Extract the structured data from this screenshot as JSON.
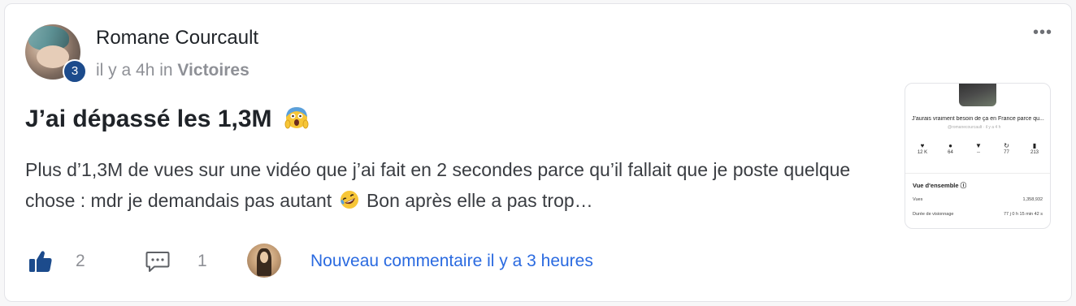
{
  "post": {
    "author": "Romane Courcault",
    "level": "3",
    "time_prefix": "il y a 4h",
    "in_word": "in",
    "space": "Victoires",
    "title": "J’ai dépassé les 1,3M",
    "body_part1": "Plus d’1,3M de vues sur une vidéo que j’ai fait en 2 secondes parce qu’il fallait que je poste quelque chose : mdr je demandais pas autant",
    "body_part2": " Bon après elle a pas trop…",
    "more_label": "•••"
  },
  "thumbnail": {
    "title": "J'aurais vraiment besoin de ça en France parce qu...",
    "subtitle": "@romanecourcault · il y a 4 h",
    "stats": [
      {
        "icon": "♥",
        "value": "12 K",
        "name": "likes"
      },
      {
        "icon": "●",
        "value": "64",
        "name": "comments"
      },
      {
        "icon": "▼",
        "value": "--",
        "name": "saves"
      },
      {
        "icon": "↻",
        "value": "77",
        "name": "shares"
      },
      {
        "icon": "▮",
        "value": "213",
        "name": "bookmarks"
      }
    ],
    "overview_label": "Vue d'ensemble ⓘ",
    "rows": [
      {
        "label": "Vues",
        "value": "1,358,932"
      },
      {
        "label": "Durée de visionnage",
        "value": "77 j 0 h 15 min 42 s"
      }
    ]
  },
  "footer": {
    "like_count": "2",
    "comment_count": "1",
    "new_comment": "Nouveau commentaire il y a 3 heures"
  },
  "icons": {
    "like": "thumbs-up-icon",
    "comment": "comment-bubble-icon",
    "title_emoji": "screaming-face-emoji",
    "body_emoji": "rofl-face-emoji"
  },
  "colors": {
    "accent": "#2a6ae0",
    "badge": "#1c4b8c",
    "like": "#1c4b8c",
    "muted": "#8e9096"
  }
}
